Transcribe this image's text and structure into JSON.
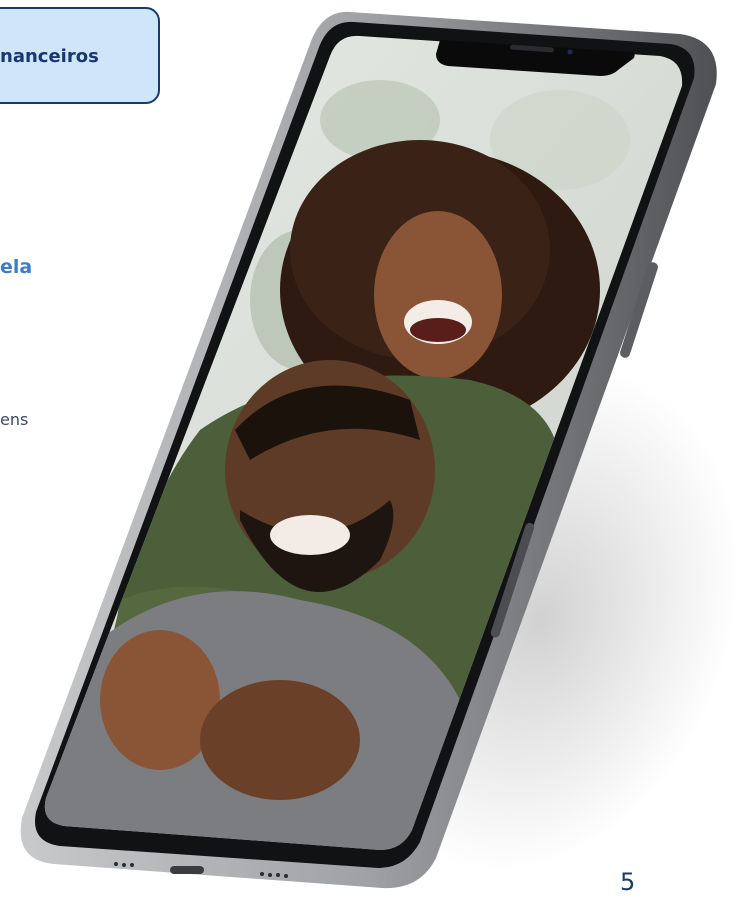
{
  "tag": {
    "text": "nanceiros"
  },
  "heading_fragment": "ela",
  "body_fragment": "ens",
  "page_number": "5",
  "colors": {
    "tag_bg": "#cfe5fa",
    "tag_border": "#1b3a6b",
    "heading": "#3f7dc2",
    "body_text": "#3a4a66"
  },
  "image": {
    "icon": "smartphone-photo-icon"
  }
}
